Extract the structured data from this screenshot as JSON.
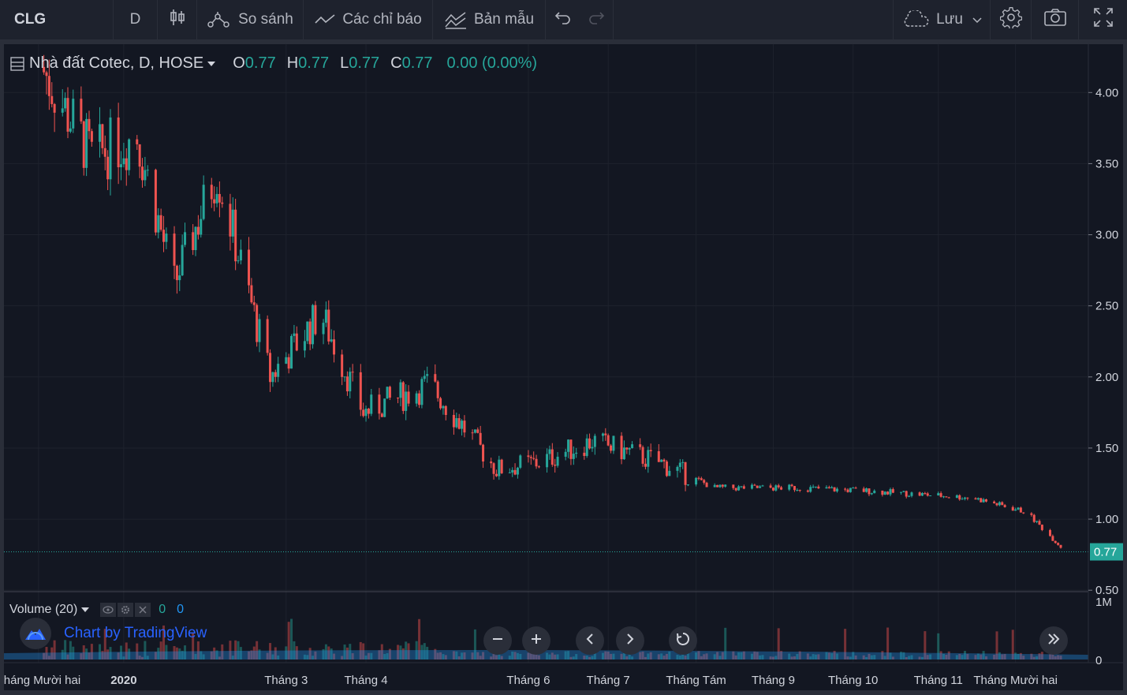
{
  "toolbar": {
    "symbol": "CLG",
    "interval": "D",
    "compare_label": "So sánh",
    "indicators_label": "Các chỉ báo",
    "templates_label": "Bản mẫu",
    "save_label": "Lưu"
  },
  "legend": {
    "title": "Nhà đất Cotec, D, HOSE",
    "o_label": "O",
    "o_value": "0.77",
    "h_label": "H",
    "h_value": "0.77",
    "l_label": "L",
    "l_value": "0.77",
    "c_label": "C",
    "c_value": "0.77",
    "change": "0.00 (0.00%)"
  },
  "volume_legend": {
    "label": "Volume (20)",
    "value1": "0",
    "value2": "0"
  },
  "branding": {
    "text": "Chart by TradingView"
  },
  "colors": {
    "up": "#26a69a",
    "down": "#ef5350",
    "background": "#131722",
    "grid": "#1e222d",
    "last_price_bg": "#26a69a"
  },
  "chart_data": {
    "type": "candlestick",
    "price_axis": {
      "ticks": [
        "4.00",
        "3.50",
        "3.00",
        "2.50",
        "2.00",
        "1.50",
        "1.00",
        "0.50"
      ],
      "range": [
        0.49,
        4.34
      ]
    },
    "last_price": {
      "value": 0.77,
      "label": "0.77"
    },
    "volume_axis": {
      "ticks": [
        "1M",
        "0"
      ]
    },
    "time_axis": {
      "labels": [
        "Tháng Mười hai",
        "2020",
        "Tháng 3",
        "Tháng 4",
        "Tháng 6",
        "Tháng 7",
        "Tháng Tám",
        "Tháng 9",
        "Tháng 10",
        "Tháng 11",
        "Tháng Mười hai"
      ],
      "bold": [
        false,
        true,
        false,
        false,
        false,
        false,
        false,
        false,
        false,
        false,
        false
      ]
    },
    "trend_points": [
      {
        "date": "2019-12-01",
        "price": 4.18
      },
      {
        "date": "2019-12-20",
        "price": 3.55
      },
      {
        "date": "2020-01-06",
        "price": 3.7
      },
      {
        "date": "2020-01-20",
        "price": 2.65
      },
      {
        "date": "2020-02-05",
        "price": 3.45
      },
      {
        "date": "2020-02-25",
        "price": 2.0
      },
      {
        "date": "2020-03-15",
        "price": 2.45
      },
      {
        "date": "2020-03-31",
        "price": 1.75
      },
      {
        "date": "2020-04-25",
        "price": 1.95
      },
      {
        "date": "2020-05-20",
        "price": 1.35
      },
      {
        "date": "2020-06-05",
        "price": 1.4
      },
      {
        "date": "2020-06-25",
        "price": 1.55
      },
      {
        "date": "2020-07-20",
        "price": 1.4
      },
      {
        "date": "2020-08-10",
        "price": 1.22
      },
      {
        "date": "2020-09-10",
        "price": 1.22
      },
      {
        "date": "2020-10-05",
        "price": 1.2
      },
      {
        "date": "2020-11-15",
        "price": 1.15
      },
      {
        "date": "2020-12-05",
        "price": 1.05
      },
      {
        "date": "2020-12-20",
        "price": 0.77
      }
    ]
  }
}
